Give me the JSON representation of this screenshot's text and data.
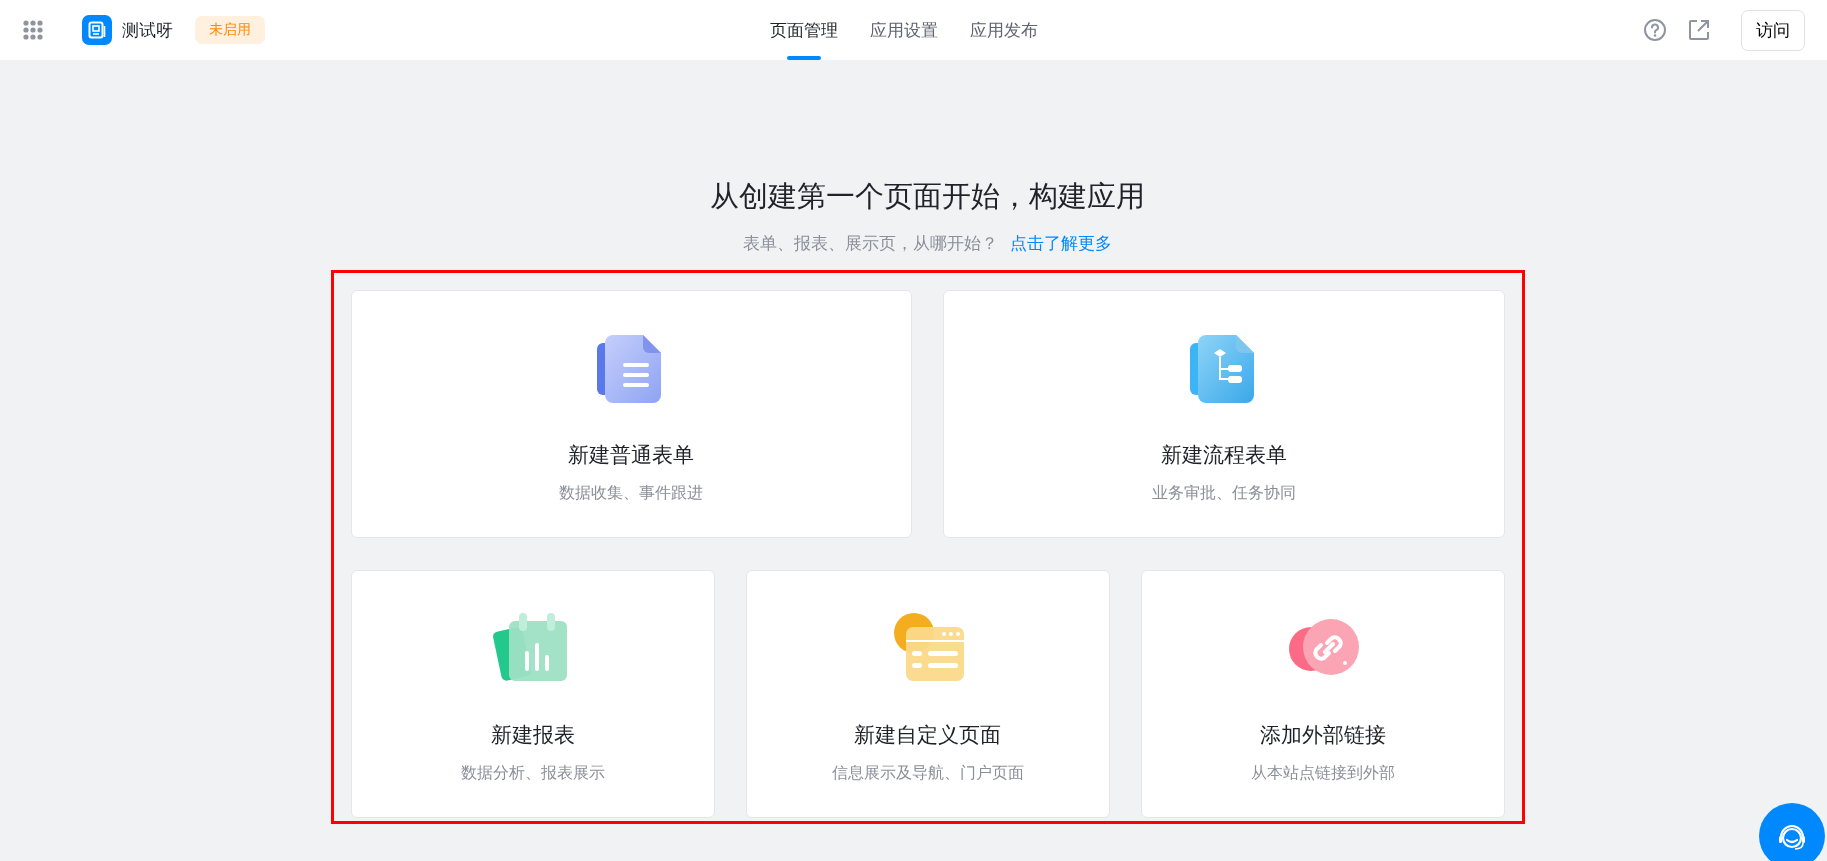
{
  "header": {
    "app_name": "测试呀",
    "status_badge": "未启用",
    "tabs": [
      {
        "label": "页面管理",
        "selected": true
      },
      {
        "label": "应用设置",
        "selected": false
      },
      {
        "label": "应用发布",
        "selected": false
      }
    ],
    "visit_button": "访问"
  },
  "hero": {
    "title": "从创建第一个页面开始，构建应用",
    "subtitle": "表单、报表、展示页，从哪开始？",
    "link": "点击了解更多"
  },
  "card_rows": [
    [
      {
        "kind": "form",
        "title": "新建普通表单",
        "description": "数据收集、事件跟进"
      },
      {
        "kind": "flow",
        "title": "新建流程表单",
        "description": "业务审批、任务协同"
      }
    ],
    [
      {
        "kind": "report",
        "title": "新建报表",
        "description": "数据分析、报表展示"
      },
      {
        "kind": "custom",
        "title": "新建自定义页面",
        "description": "信息展示及导航、门户页面"
      },
      {
        "kind": "link",
        "title": "添加外部链接",
        "description": "从本站点链接到外部"
      }
    ]
  ]
}
